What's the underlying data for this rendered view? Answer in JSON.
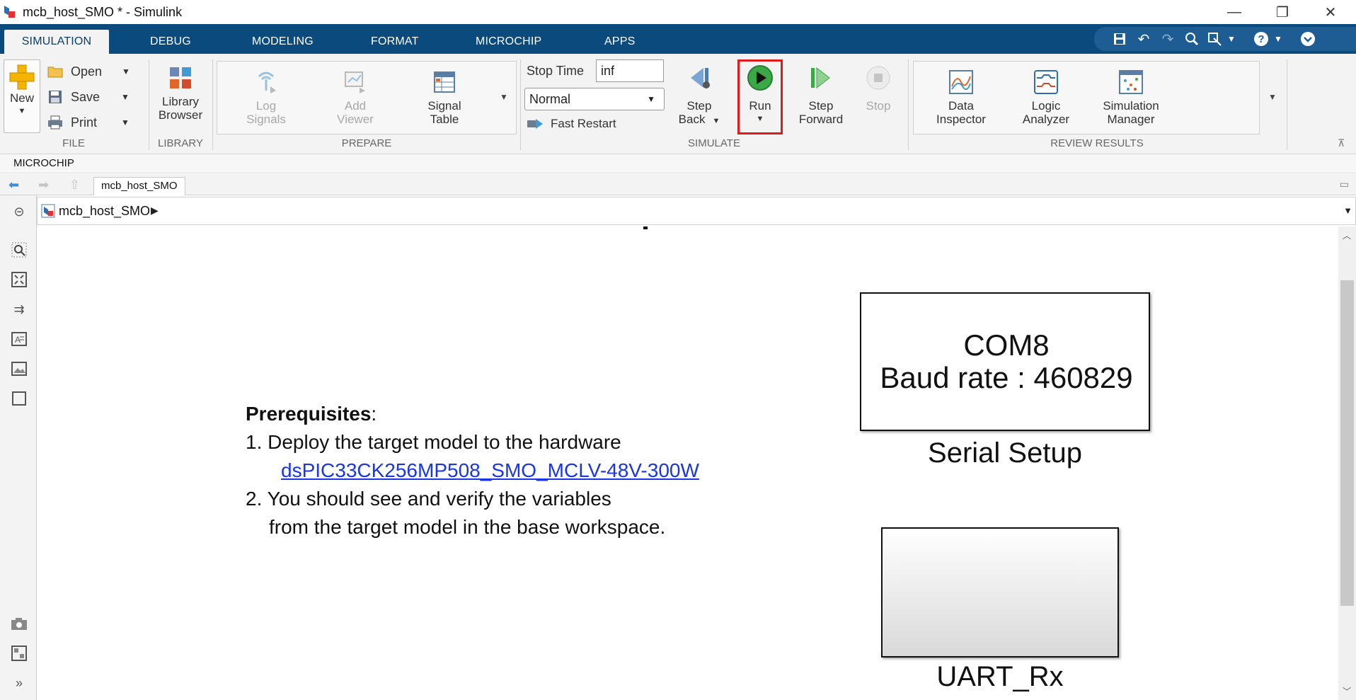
{
  "window": {
    "title": "mcb_host_SMO * - Simulink",
    "minimize": "—",
    "maximize": "❐",
    "close": "✕"
  },
  "tabs": [
    {
      "label": "SIMULATION",
      "active": true
    },
    {
      "label": "DEBUG"
    },
    {
      "label": "MODELING"
    },
    {
      "label": "FORMAT"
    },
    {
      "label": "MICROCHIP"
    },
    {
      "label": "APPS"
    }
  ],
  "ribbon": {
    "file": {
      "label": "FILE",
      "new": "New",
      "open": "Open",
      "save": "Save",
      "print": "Print"
    },
    "library": {
      "label": "LIBRARY",
      "browser_line1": "Library",
      "browser_line2": "Browser"
    },
    "prepare": {
      "label": "PREPARE",
      "log_line1": "Log",
      "log_line2": "Signals",
      "add_line1": "Add",
      "add_line2": "Viewer",
      "sig_line1": "Signal",
      "sig_line2": "Table"
    },
    "simulate": {
      "label": "SIMULATE",
      "stop_time_label": "Stop Time",
      "stop_time_value": "inf",
      "mode": "Normal",
      "fast_restart": "Fast Restart",
      "step_back_line1": "Step",
      "step_back_line2": "Back",
      "run": "Run",
      "step_fwd_line1": "Step",
      "step_fwd_line2": "Forward",
      "stop": "Stop"
    },
    "review": {
      "label": "REVIEW RESULTS",
      "data_line1": "Data",
      "data_line2": "Inspector",
      "logic_line1": "Logic",
      "logic_line2": "Analyzer",
      "sim_line1": "Simulation",
      "sim_line2": "Manager"
    }
  },
  "toolstrip": {
    "microchip_label": "MICROCHIP"
  },
  "breadcrumb": {
    "tab": "mcb_host_SMO",
    "path": "mcb_host_SMO"
  },
  "canvas": {
    "prereq_title": "Prerequisites",
    "prereq_colon": ":",
    "line1": "1. Deploy the target model to the hardware",
    "link": "dsPIC33CK256MP508_SMO_MCLV-48V-300W",
    "line2": "2. You should see and verify the variables",
    "line3": "from the target model in the base workspace.",
    "serial_block_line1": "COM8",
    "serial_block_line2": "Baud rate : 460829",
    "serial_block_name": "Serial Setup",
    "uart_block_name": "UART_Rx"
  },
  "colors": {
    "tabbar": "#0a4a7d",
    "run_highlight": "#e01b1b",
    "link": "#1a35e6"
  }
}
